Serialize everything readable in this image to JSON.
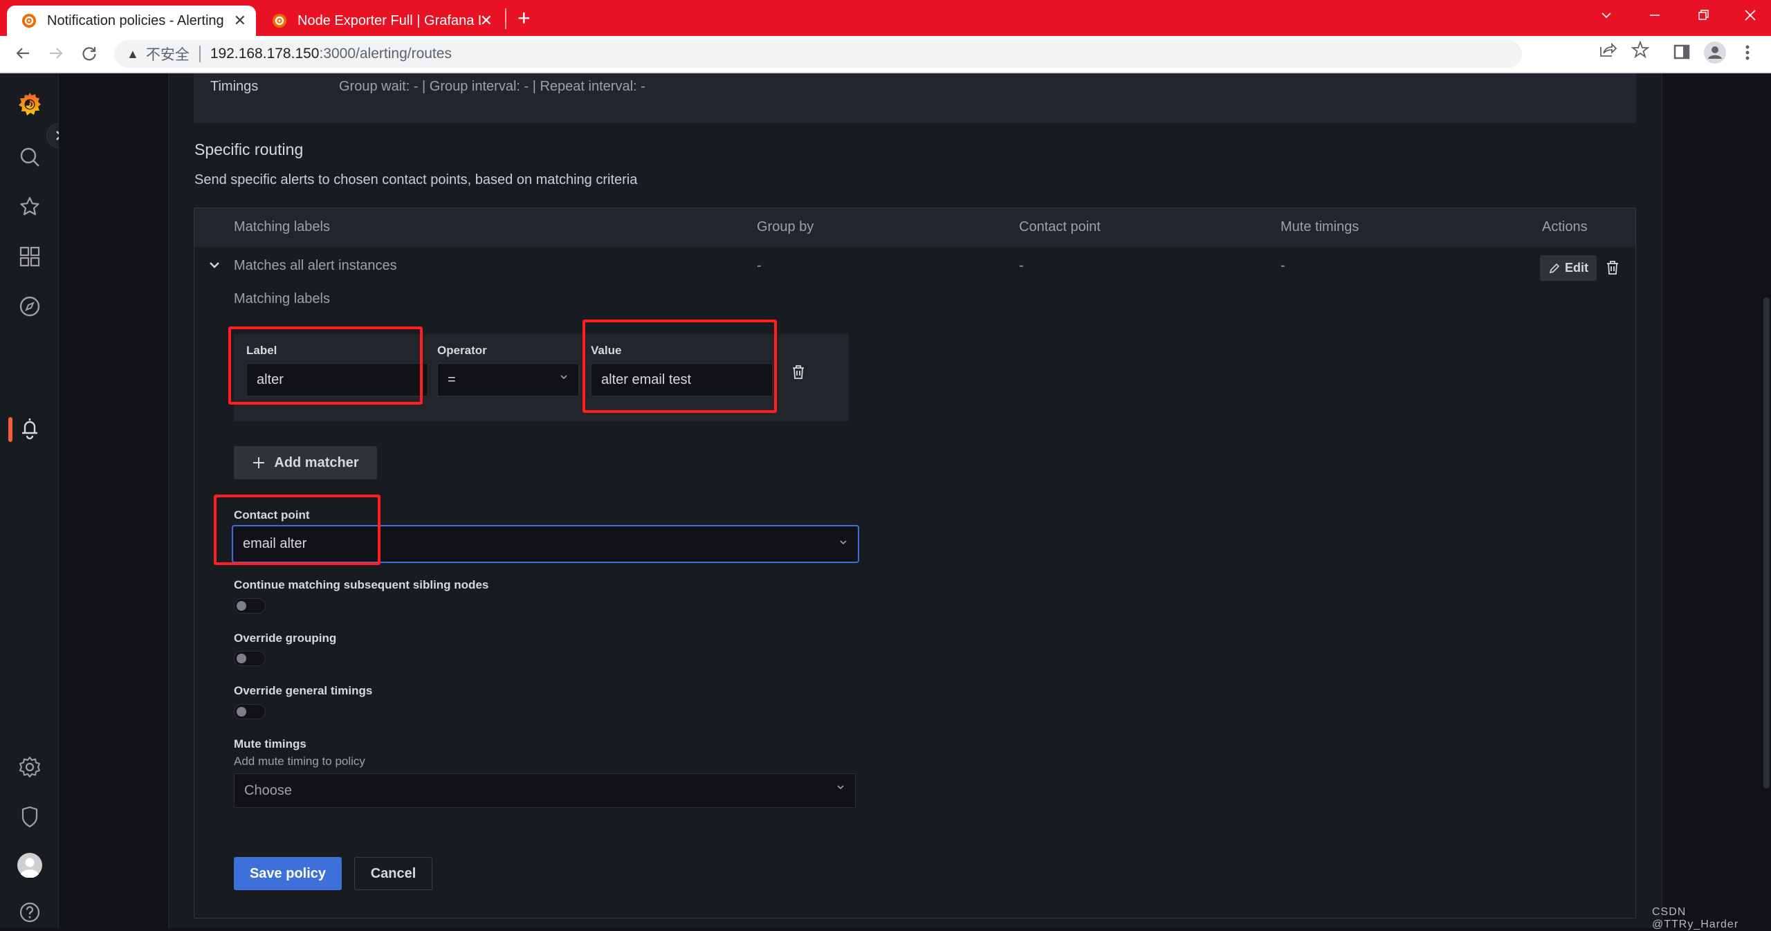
{
  "browser": {
    "tabs": [
      {
        "title": "Notification policies - Alerting",
        "active": true,
        "favicon": "grafana-logo-icon"
      },
      {
        "title": "Node Exporter Full | Grafana Labs",
        "active": false,
        "favicon": "grafana-logo-icon"
      }
    ],
    "new_tab": "+",
    "close_glyph": "✕",
    "address": {
      "security_label": "不安全",
      "host": "192.168.178.150",
      "path": ":3000/alerting/routes"
    },
    "accent_color": "#e81224"
  },
  "sidebar": {
    "items": [
      {
        "name": "grafana-home",
        "icon": "grafana-logo-icon"
      },
      {
        "name": "search",
        "icon": "search-icon"
      },
      {
        "name": "starred",
        "icon": "star-icon"
      },
      {
        "name": "dashboards",
        "icon": "apps-grid-icon"
      },
      {
        "name": "explore",
        "icon": "compass-icon"
      },
      {
        "name": "alerting",
        "icon": "bell-icon",
        "active": true
      },
      {
        "name": "configuration",
        "icon": "gear-icon"
      },
      {
        "name": "server-admin",
        "icon": "shield-icon"
      },
      {
        "name": "profile",
        "icon": "avatar-icon"
      },
      {
        "name": "help",
        "icon": "help-icon"
      }
    ],
    "active_color": "#f55f3e"
  },
  "default_policy": {
    "timings_label": "Timings",
    "timings_value": "Group wait: - | Group interval: - | Repeat interval: -"
  },
  "specific_routing": {
    "title": "Specific routing",
    "description": "Send specific alerts to chosen contact points, based on matching criteria",
    "columns": [
      "Matching labels",
      "Group by",
      "Contact point",
      "Mute timings",
      "Actions"
    ],
    "row": {
      "matching": "Matches all alert instances",
      "group_by": "-",
      "contact_point": "-",
      "mute_timings": "-",
      "edit_label": "Edit"
    }
  },
  "policy_form": {
    "matching_labels_heading": "Matching labels",
    "matcher": {
      "label_title": "Label",
      "label_value": "alter",
      "operator_title": "Operator",
      "operator_value": "=",
      "value_title": "Value",
      "value_value": "alter email test"
    },
    "add_matcher_label": "Add matcher",
    "contact_point": {
      "title": "Contact point",
      "value": "email alter"
    },
    "toggles": [
      {
        "label": "Continue matching subsequent sibling nodes",
        "on": false
      },
      {
        "label": "Override grouping",
        "on": false
      },
      {
        "label": "Override general timings",
        "on": false
      }
    ],
    "mute_timings": {
      "title": "Mute timings",
      "description": "Add mute timing to policy",
      "placeholder": "Choose"
    },
    "save_label": "Save policy",
    "cancel_label": "Cancel",
    "primary_color": "#3d71d9"
  },
  "watermark": "CSDN @TTRy_Harder"
}
